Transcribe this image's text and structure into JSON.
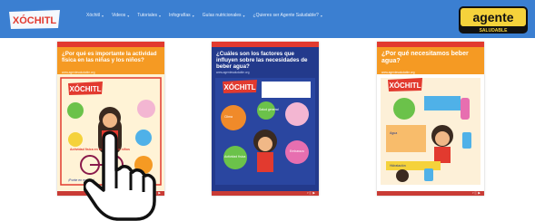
{
  "header": {
    "brand": "XÓCHITL",
    "nav": [
      {
        "label": "Xóchitl",
        "has_dropdown": true
      },
      {
        "label": "Videos",
        "has_dropdown": true
      },
      {
        "label": "Tutoriales",
        "has_dropdown": true
      },
      {
        "label": "Infografías",
        "has_dropdown": true
      },
      {
        "label": "Guías nutricionales",
        "has_dropdown": true
      },
      {
        "label": "¿Quieres ser Agente Saludable?",
        "has_dropdown": true
      }
    ],
    "badge": {
      "line1": "agente",
      "line2": "SALUDABLE"
    }
  },
  "cards": [
    {
      "title": "¿Por qué es importante la actividad física en las niñas y los niños?",
      "subtitle": "www.agentesaludable.org",
      "labels": [
        "Actividad física en las niñas y los niños",
        "¡Ponte en marcha!"
      ],
      "footer": "f ⓘ ▶"
    },
    {
      "title": "¿Cuáles son los factores que influyen sobre las necesidades de beber agua?",
      "subtitle": "www.agentesaludable.org",
      "labels": [
        "Clima",
        "Salud general",
        "Embarazo",
        "Actividad física"
      ],
      "footer": "f ⓘ ▶"
    },
    {
      "title": "¿Por qué necesitamos beber agua?",
      "subtitle": "www.agentesaludable.org",
      "labels": [
        "Agua",
        "Hidratación"
      ],
      "footer": "f ⓘ ▶"
    }
  ],
  "icons": {
    "pointer": "hand-pointer-icon",
    "chevron": "chevron-down-icon"
  },
  "colors": {
    "nav_bg": "#3b7fd1",
    "brand_red": "#e23a2f",
    "card_orange": "#f59a23",
    "card_navy": "#233a8c",
    "footer_red": "#c93b35"
  }
}
